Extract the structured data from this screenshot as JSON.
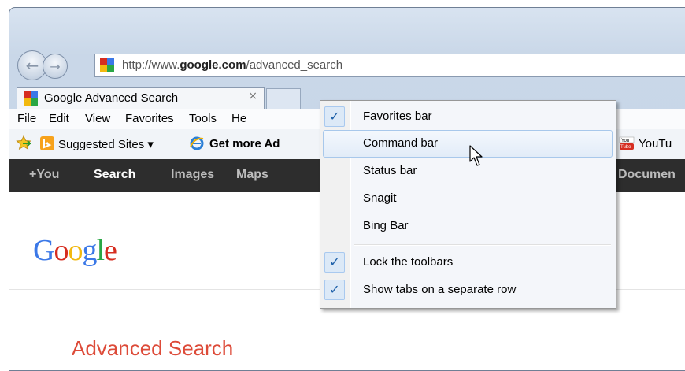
{
  "address": {
    "prefix": "http://www.",
    "domain": "google.com",
    "path": "/advanced_search"
  },
  "tab": {
    "title": "Google Advanced Search",
    "close": "×"
  },
  "menubar": [
    "File",
    "Edit",
    "View",
    "Favorites",
    "Tools",
    "He"
  ],
  "favorites": {
    "suggested": "Suggested Sites ▾",
    "getmore": "Get more Ad",
    "youtube": "YouTu"
  },
  "google_bar": {
    "you": "+You",
    "search": "Search",
    "images": "Images",
    "maps": "Maps",
    "documents": "Documen"
  },
  "logo": "Google",
  "page_heading": "Advanced Search",
  "context_menu": {
    "items": [
      {
        "label": "Favorites bar",
        "checked": true
      },
      {
        "label": "Command bar",
        "checked": false,
        "highlighted": true
      },
      {
        "label": "Status bar",
        "checked": false
      },
      {
        "label": "Snagit",
        "checked": false
      },
      {
        "label": "Bing Bar",
        "checked": false
      },
      {
        "label": "Lock the toolbars",
        "checked": true
      },
      {
        "label": "Show tabs on a separate row",
        "checked": true
      }
    ],
    "check_glyph": "✓"
  },
  "colors": {
    "google_red": "#dd4b39",
    "dark_bar": "#2d2d2d",
    "highlight_border": "#a8c8eb"
  },
  "icons": [
    "back-arrow-icon",
    "forward-arrow-icon",
    "google-favicon",
    "favorites-star-icon",
    "bing-icon",
    "ie-icon",
    "youtube-icon",
    "mouse-cursor-icon"
  ]
}
